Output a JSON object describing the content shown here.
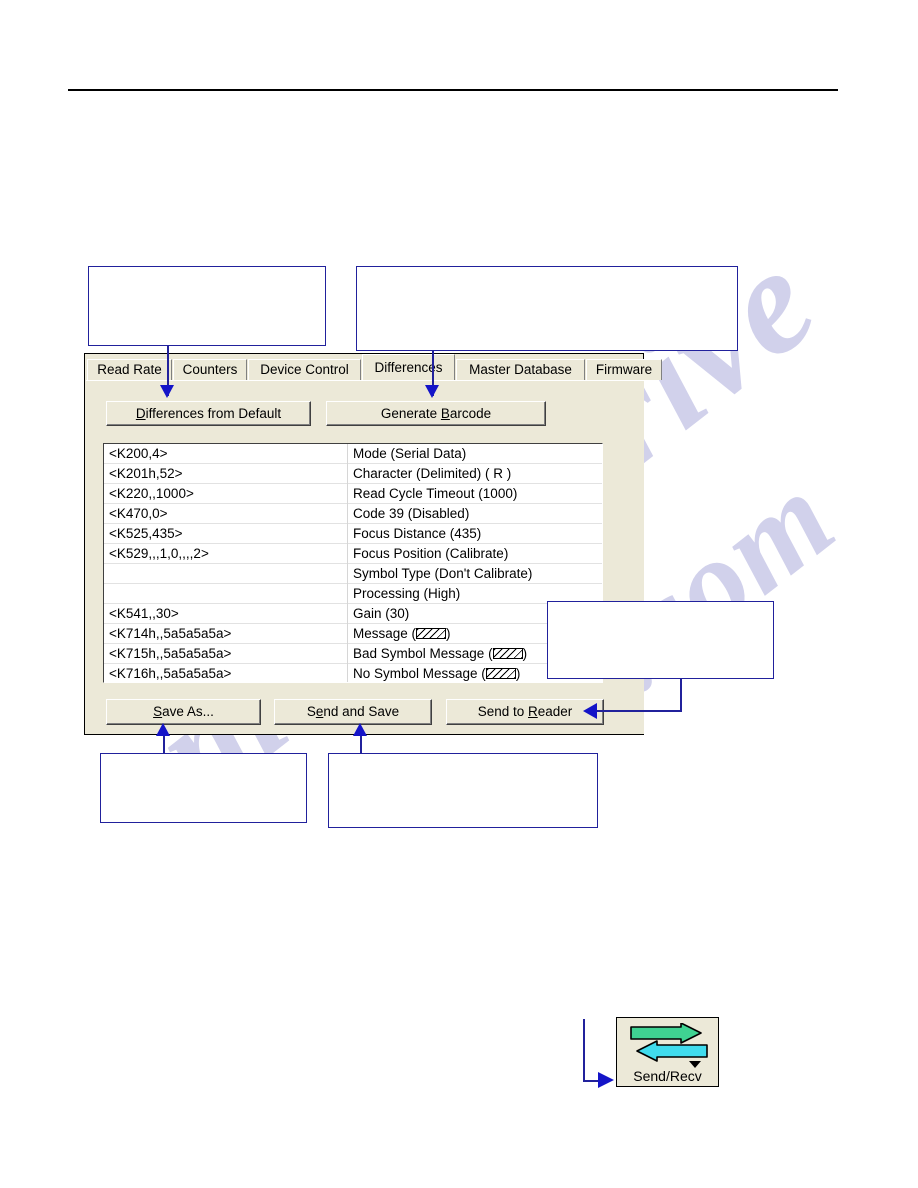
{
  "document": {
    "watermark_text_1": "manualsrive",
    "watermark_text_2": "e.com"
  },
  "dialog": {
    "tabs": [
      {
        "id": "read-rate",
        "label": "Read Rate",
        "selected": false
      },
      {
        "id": "counters",
        "label": "Counters",
        "selected": false
      },
      {
        "id": "device-control",
        "label": "Device Control",
        "selected": false
      },
      {
        "id": "differences",
        "label": "Differences",
        "selected": true
      },
      {
        "id": "master-database",
        "label": "Master Database",
        "selected": false
      },
      {
        "id": "firmware",
        "label": "Firmware",
        "selected": false
      }
    ],
    "toolbar_buttons": {
      "differences_from_default": "Differences from Default",
      "differences_from_default_accel": "D",
      "generate_barcode": "Generate Barcode",
      "generate_barcode_accel": "B"
    },
    "action_buttons": {
      "save_as": "Save As...",
      "save_as_accel": "S",
      "send_and_save": "Send and Save",
      "send_and_save_accel": "e",
      "send_to_reader": "Send to Reader",
      "send_to_reader_accel": "R"
    },
    "list": {
      "rows": [
        {
          "command": "<K200,4>",
          "description": "Mode (Serial Data)"
        },
        {
          "command": "<K201h,52>",
          "description": "Character (Delimited) ( R  )"
        },
        {
          "command": "<K220,,1000>",
          "description": "Read Cycle Timeout (1000)"
        },
        {
          "command": "<K470,0>",
          "description": "Code 39 (Disabled)"
        },
        {
          "command": "<K525,435>",
          "description": "Focus Distance (435)"
        },
        {
          "command": "<K529,,,1,0,,,,2>",
          "description": "Focus Position (Calibrate)"
        },
        {
          "command": "",
          "description": "Symbol Type (Don't Calibrate)"
        },
        {
          "command": "",
          "description": "Processing (High)"
        },
        {
          "command": "<K541,,30>",
          "description": "Gain (30)"
        },
        {
          "command": "<K714h,,5a5a5a5a>",
          "description": "Message (",
          "description_suffix": ")",
          "hatched": true
        },
        {
          "command": "<K715h,,5a5a5a5a>",
          "description": "Bad Symbol Message (",
          "description_suffix": ")",
          "hatched": true
        },
        {
          "command": "<K716h,,5a5a5a5a>",
          "description": "No Symbol Message (",
          "description_suffix": ")",
          "hatched": true
        }
      ]
    }
  },
  "toolbar_button": {
    "label": "Send/Recv",
    "arrow_right_color": "#33cc88",
    "arrow_left_color": "#33dde8"
  },
  "callouts": {
    "accent_color": "#21219c",
    "arrow_color": "#1414c8",
    "items": [
      {
        "id": "tabs-callout",
        "text": ""
      },
      {
        "id": "buttons-callout",
        "text": ""
      },
      {
        "id": "send-callout",
        "text": ""
      },
      {
        "id": "save-as-callout",
        "text": ""
      },
      {
        "id": "send-save-callout",
        "text": ""
      }
    ]
  }
}
